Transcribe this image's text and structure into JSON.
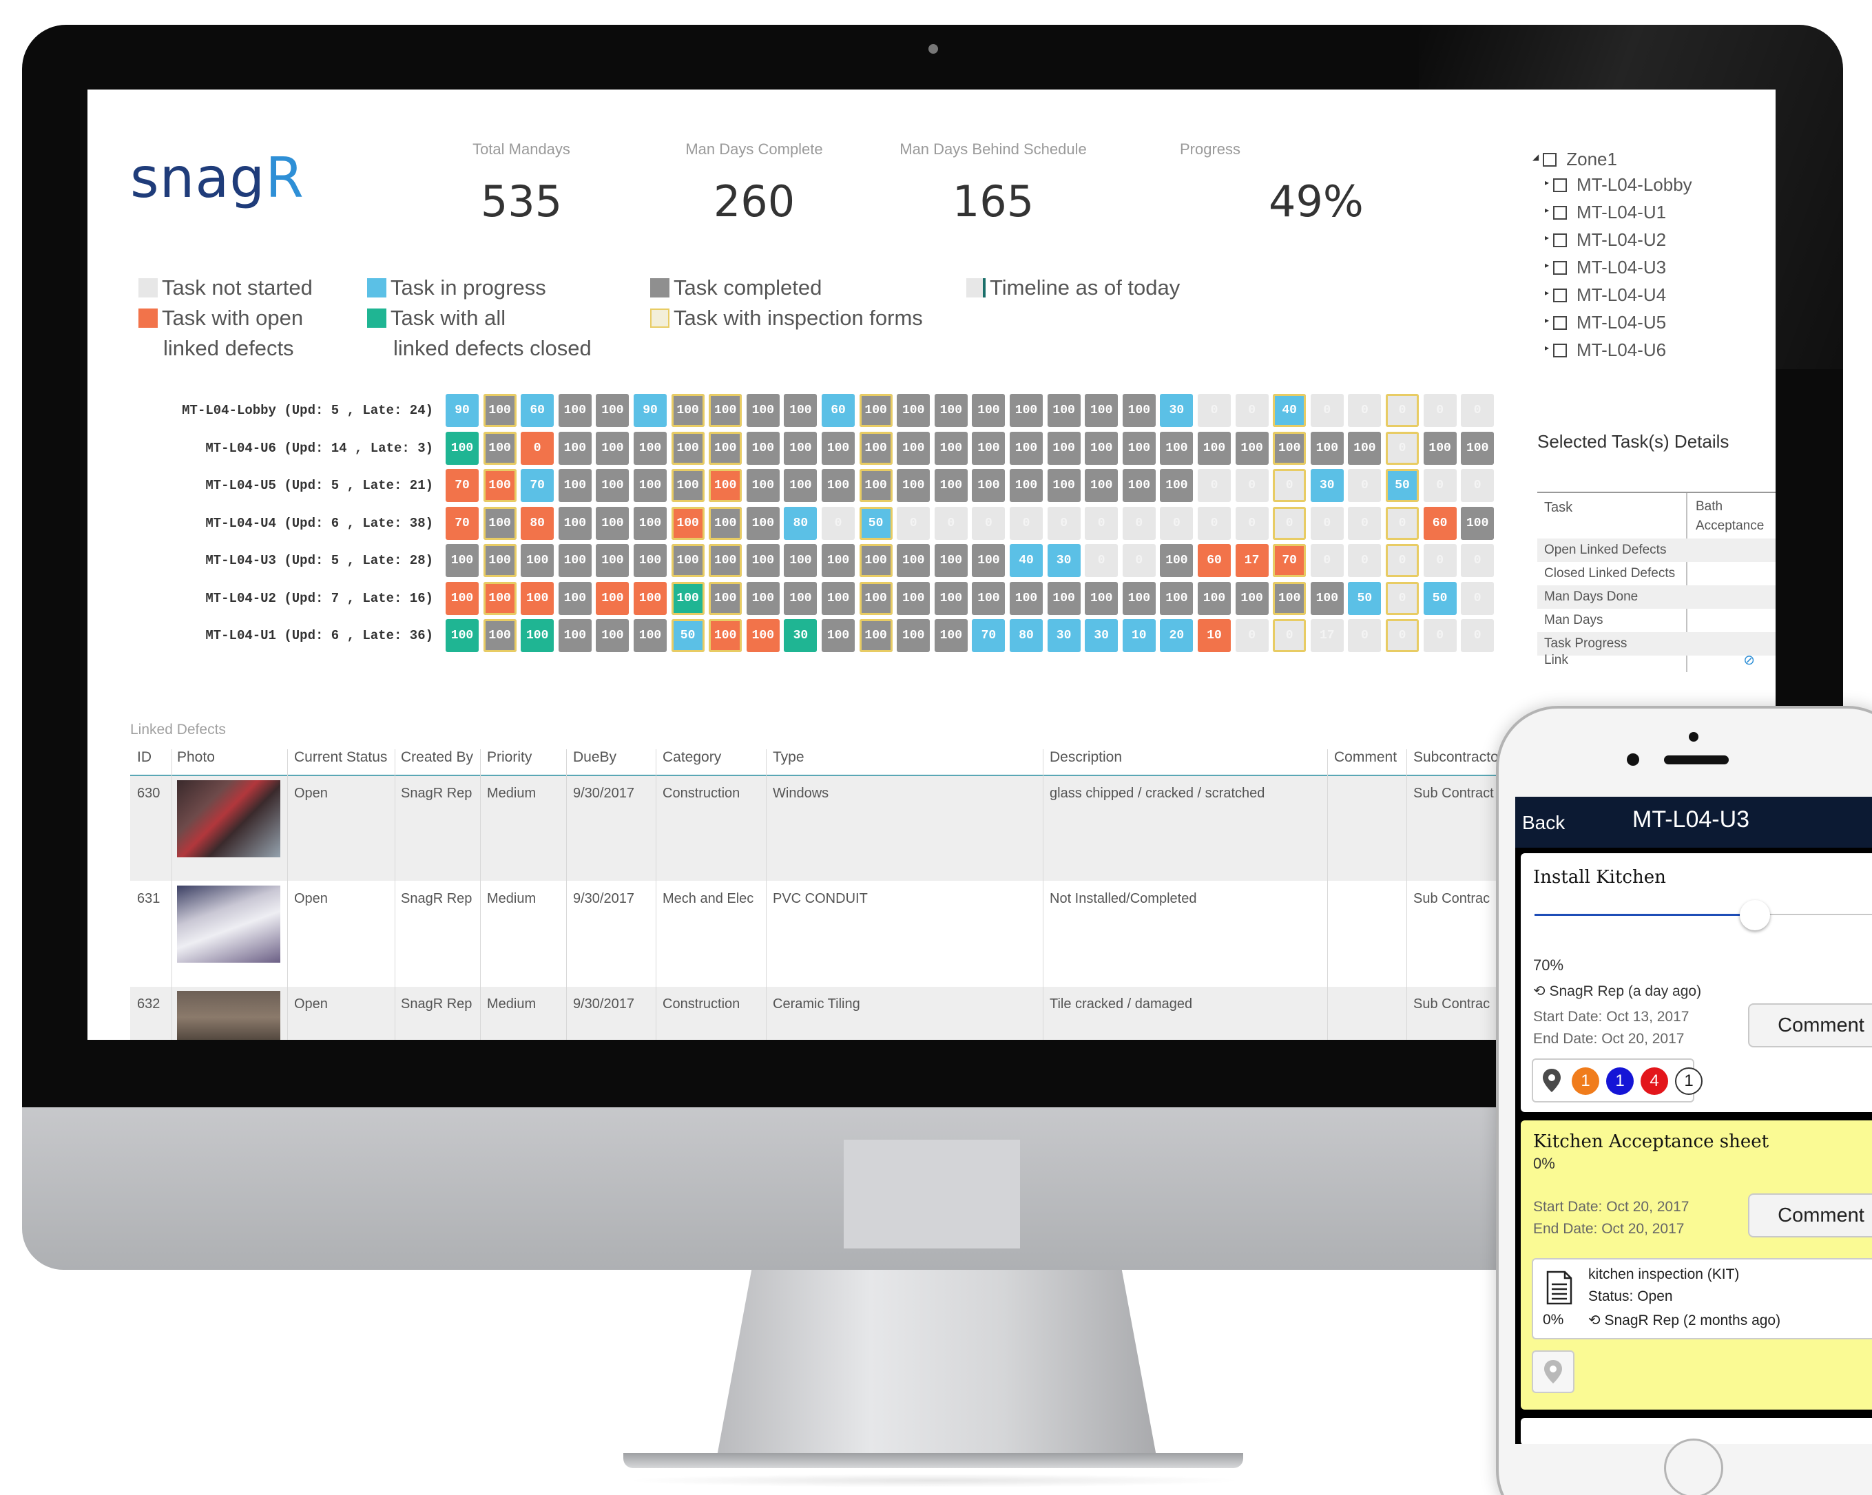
{
  "app": {
    "logo_text": "snagR"
  },
  "kpis": [
    {
      "label": "Total Mandays",
      "value": "535"
    },
    {
      "label": "Man Days Complete",
      "value": "260"
    },
    {
      "label": "Man Days Behind Schedule",
      "value": "165"
    },
    {
      "label": "Progress",
      "value": "49%"
    }
  ],
  "legend": {
    "not_started": "Task not started",
    "open_defects": [
      "Task with open",
      "linked defects"
    ],
    "in_progress": "Task in progress",
    "all_closed": [
      "Task with all",
      "linked defects closed"
    ],
    "completed": "Task completed",
    "inspection": "Task with inspection forms",
    "timeline": "Timeline as of today",
    "colors": {
      "not_started": "#e7e7e7",
      "open_defects": "#f2734a",
      "in_progress": "#5bc0e6",
      "all_closed": "#1fb593",
      "completed": "#8f8f8f",
      "inspection": "#f3efd9",
      "timeline": "#1a6f6a"
    }
  },
  "tree": {
    "root": "Zone1",
    "children": [
      "MT-L04-Lobby",
      "MT-L04-U1",
      "MT-L04-U2",
      "MT-L04-U3",
      "MT-L04-U4",
      "MT-L04-U5",
      "MT-L04-U6"
    ]
  },
  "selected": {
    "title": "Selected Task(s) Details",
    "task_label": "Task",
    "column": "Bath Acceptance Inspection",
    "rows": [
      "Open Linked Defects",
      "Closed Linked Defects",
      "Man Days Done",
      "Man Days",
      "Task Progress",
      "Link"
    ]
  },
  "grid": {
    "rows": [
      {
        "label": "MT-L04-Lobby (Upd: 5 , Late: 24)",
        "cells": [
          [
            "b",
            "90"
          ],
          [
            "g",
            "100"
          ],
          [
            "b",
            "60"
          ],
          [
            "g",
            "100"
          ],
          [
            "g",
            "100"
          ],
          [
            "b",
            "90"
          ],
          [
            "g",
            "100"
          ],
          [
            "g",
            "100"
          ],
          [
            "g",
            "100"
          ],
          [
            "g",
            "100"
          ],
          [
            "b",
            "60"
          ],
          [
            "g",
            "100"
          ],
          [
            "g",
            "100"
          ],
          [
            "g",
            "100"
          ],
          [
            "g",
            "100"
          ],
          [
            "g",
            "100"
          ],
          [
            "g",
            "100"
          ],
          [
            "g",
            "100"
          ],
          [
            "g",
            "100"
          ],
          [
            "b",
            "30"
          ],
          [
            "l",
            "0"
          ],
          [
            "l",
            "0"
          ],
          [
            "b",
            "40"
          ],
          [
            "l",
            "0"
          ],
          [
            "l",
            "0"
          ],
          [
            "l",
            "0"
          ],
          [
            "l",
            "0"
          ],
          [
            "l",
            "0"
          ]
        ]
      },
      {
        "label": "MT-L04-U6 (Upd: 14 , Late: 3)",
        "cells": [
          [
            "t",
            "100"
          ],
          [
            "g",
            "100"
          ],
          [
            "o",
            "0"
          ],
          [
            "g",
            "100"
          ],
          [
            "g",
            "100"
          ],
          [
            "g",
            "100"
          ],
          [
            "g",
            "100"
          ],
          [
            "g",
            "100"
          ],
          [
            "g",
            "100"
          ],
          [
            "g",
            "100"
          ],
          [
            "g",
            "100"
          ],
          [
            "g",
            "100"
          ],
          [
            "g",
            "100"
          ],
          [
            "g",
            "100"
          ],
          [
            "g",
            "100"
          ],
          [
            "g",
            "100"
          ],
          [
            "g",
            "100"
          ],
          [
            "g",
            "100"
          ],
          [
            "g",
            "100"
          ],
          [
            "g",
            "100"
          ],
          [
            "g",
            "100"
          ],
          [
            "g",
            "100"
          ],
          [
            "g",
            "100"
          ],
          [
            "g",
            "100"
          ],
          [
            "g",
            "100"
          ],
          [
            "l",
            "0"
          ],
          [
            "g",
            "100"
          ],
          [
            "g",
            "100"
          ]
        ]
      },
      {
        "label": "MT-L04-U5 (Upd: 5 , Late: 21)",
        "cells": [
          [
            "o",
            "70"
          ],
          [
            "o",
            "100"
          ],
          [
            "b",
            "70"
          ],
          [
            "g",
            "100"
          ],
          [
            "g",
            "100"
          ],
          [
            "g",
            "100"
          ],
          [
            "g",
            "100"
          ],
          [
            "o",
            "100"
          ],
          [
            "g",
            "100"
          ],
          [
            "g",
            "100"
          ],
          [
            "g",
            "100"
          ],
          [
            "g",
            "100"
          ],
          [
            "g",
            "100"
          ],
          [
            "g",
            "100"
          ],
          [
            "g",
            "100"
          ],
          [
            "g",
            "100"
          ],
          [
            "g",
            "100"
          ],
          [
            "g",
            "100"
          ],
          [
            "g",
            "100"
          ],
          [
            "g",
            "100"
          ],
          [
            "l",
            "0"
          ],
          [
            "l",
            "0"
          ],
          [
            "l",
            "0"
          ],
          [
            "b",
            "30"
          ],
          [
            "l",
            "0"
          ],
          [
            "b",
            "50"
          ],
          [
            "l",
            "0"
          ],
          [
            "l",
            "0"
          ]
        ]
      },
      {
        "label": "MT-L04-U4 (Upd: 6 , Late: 38)",
        "cells": [
          [
            "o",
            "70"
          ],
          [
            "g",
            "100"
          ],
          [
            "o",
            "80"
          ],
          [
            "g",
            "100"
          ],
          [
            "g",
            "100"
          ],
          [
            "g",
            "100"
          ],
          [
            "o",
            "100"
          ],
          [
            "g",
            "100"
          ],
          [
            "g",
            "100"
          ],
          [
            "b",
            "80"
          ],
          [
            "l",
            "0"
          ],
          [
            "b",
            "50"
          ],
          [
            "l",
            "0"
          ],
          [
            "l",
            "0"
          ],
          [
            "l",
            "0"
          ],
          [
            "l",
            "0"
          ],
          [
            "l",
            "0"
          ],
          [
            "l",
            "0"
          ],
          [
            "l",
            "0"
          ],
          [
            "l",
            "0"
          ],
          [
            "l",
            "0"
          ],
          [
            "l",
            "0"
          ],
          [
            "l",
            "0"
          ],
          [
            "l",
            "0"
          ],
          [
            "l",
            "0"
          ],
          [
            "l",
            "0"
          ],
          [
            "o",
            "60"
          ],
          [
            "g",
            "100"
          ]
        ]
      },
      {
        "label": "MT-L04-U3 (Upd: 5 , Late: 28)",
        "cells": [
          [
            "g",
            "100"
          ],
          [
            "g",
            "100"
          ],
          [
            "g",
            "100"
          ],
          [
            "g",
            "100"
          ],
          [
            "g",
            "100"
          ],
          [
            "g",
            "100"
          ],
          [
            "g",
            "100"
          ],
          [
            "g",
            "100"
          ],
          [
            "g",
            "100"
          ],
          [
            "g",
            "100"
          ],
          [
            "g",
            "100"
          ],
          [
            "g",
            "100"
          ],
          [
            "g",
            "100"
          ],
          [
            "g",
            "100"
          ],
          [
            "g",
            "100"
          ],
          [
            "b",
            "40"
          ],
          [
            "b",
            "30"
          ],
          [
            "l",
            "0"
          ],
          [
            "l",
            "0"
          ],
          [
            "g",
            "100"
          ],
          [
            "o",
            "60"
          ],
          [
            "o",
            "17"
          ],
          [
            "o",
            "70"
          ],
          [
            "l",
            "0"
          ],
          [
            "l",
            "0"
          ],
          [
            "l",
            "0"
          ],
          [
            "l",
            "0"
          ],
          [
            "l",
            "0"
          ]
        ]
      },
      {
        "label": "MT-L04-U2 (Upd: 7 , Late: 16)",
        "cells": [
          [
            "o",
            "100"
          ],
          [
            "o",
            "100"
          ],
          [
            "o",
            "100"
          ],
          [
            "g",
            "100"
          ],
          [
            "o",
            "100"
          ],
          [
            "o",
            "100"
          ],
          [
            "t",
            "100"
          ],
          [
            "g",
            "100"
          ],
          [
            "g",
            "100"
          ],
          [
            "g",
            "100"
          ],
          [
            "g",
            "100"
          ],
          [
            "g",
            "100"
          ],
          [
            "g",
            "100"
          ],
          [
            "g",
            "100"
          ],
          [
            "g",
            "100"
          ],
          [
            "g",
            "100"
          ],
          [
            "g",
            "100"
          ],
          [
            "g",
            "100"
          ],
          [
            "g",
            "100"
          ],
          [
            "g",
            "100"
          ],
          [
            "g",
            "100"
          ],
          [
            "g",
            "100"
          ],
          [
            "g",
            "100"
          ],
          [
            "g",
            "100"
          ],
          [
            "b",
            "50"
          ],
          [
            "l",
            "0"
          ],
          [
            "b",
            "50"
          ],
          [
            "l",
            "0"
          ]
        ]
      },
      {
        "label": "MT-L04-U1 (Upd: 6 , Late: 36)",
        "cells": [
          [
            "t",
            "100"
          ],
          [
            "g",
            "100"
          ],
          [
            "t",
            "100"
          ],
          [
            "g",
            "100"
          ],
          [
            "g",
            "100"
          ],
          [
            "g",
            "100"
          ],
          [
            "b",
            "50"
          ],
          [
            "o",
            "100"
          ],
          [
            "o",
            "100"
          ],
          [
            "t",
            "30"
          ],
          [
            "g",
            "100"
          ],
          [
            "g",
            "100"
          ],
          [
            "g",
            "100"
          ],
          [
            "g",
            "100"
          ],
          [
            "b",
            "70"
          ],
          [
            "b",
            "80"
          ],
          [
            "b",
            "30"
          ],
          [
            "b",
            "30"
          ],
          [
            "b",
            "10"
          ],
          [
            "b",
            "20"
          ],
          [
            "o",
            "10"
          ],
          [
            "l",
            "0"
          ],
          [
            "l",
            "0"
          ],
          [
            "l",
            "17"
          ],
          [
            "l",
            "0"
          ],
          [
            "l",
            "0"
          ],
          [
            "l",
            "0"
          ],
          [
            "l",
            "0"
          ]
        ]
      }
    ],
    "inspection_columns": [
      1,
      6,
      7,
      11,
      22,
      25
    ]
  },
  "defects": {
    "section_label": "Linked Defects",
    "columns": [
      "ID",
      "Photo",
      "Current Status",
      "Created By",
      "Priority",
      "DueBy",
      "Category",
      "Type",
      "Description",
      "Comment",
      "Subcontractor"
    ],
    "rows": [
      {
        "id": "630",
        "status": "Open",
        "created_by": "SnagR Rep",
        "priority": "Medium",
        "dueby": "9/30/2017",
        "category": "Construction",
        "type": "Windows",
        "description": "glass chipped / cracked / scratched",
        "subcontractor": "Sub Contract"
      },
      {
        "id": "631",
        "status": "Open",
        "created_by": "SnagR Rep",
        "priority": "Medium",
        "dueby": "9/30/2017",
        "category": "Mech and Elec",
        "type": "PVC CONDUIT",
        "description": "Not Installed/Completed",
        "subcontractor": "Sub Contrac"
      },
      {
        "id": "632",
        "status": "Open",
        "created_by": "SnagR Rep",
        "priority": "Medium",
        "dueby": "9/30/2017",
        "category": "Construction",
        "type": "Ceramic Tiling",
        "description": "Tile cracked / damaged",
        "subcontractor": "Sub Contrac"
      }
    ]
  },
  "phone": {
    "back": "Back",
    "title": "MT-L04-U3",
    "task1": {
      "name": "Install Kitchen",
      "progress_text": "70%",
      "progress_value": 70,
      "updated_by": "SnagR Rep (a day ago)",
      "start": "Start Date: Oct 13, 2017",
      "end": "End Date: Oct 20, 2017",
      "comment": "Comment",
      "badges": [
        {
          "value": "1",
          "color": "#f07c1c"
        },
        {
          "value": "1",
          "color": "#1515d6"
        },
        {
          "value": "4",
          "color": "#e3161b"
        },
        {
          "value": "1",
          "color": "#ffffff"
        }
      ]
    },
    "task2": {
      "name": "Kitchen Acceptance sheet",
      "progress_text": "0%",
      "start": "Start Date: Oct 20, 2017",
      "end": "End Date: Oct 20, 2017",
      "comment": "Comment",
      "form_name": "kitchen inspection (KIT)",
      "form_status": "Status: Open",
      "form_progress": "0%",
      "form_updated_by": "SnagR Rep (2 months ago)"
    }
  }
}
